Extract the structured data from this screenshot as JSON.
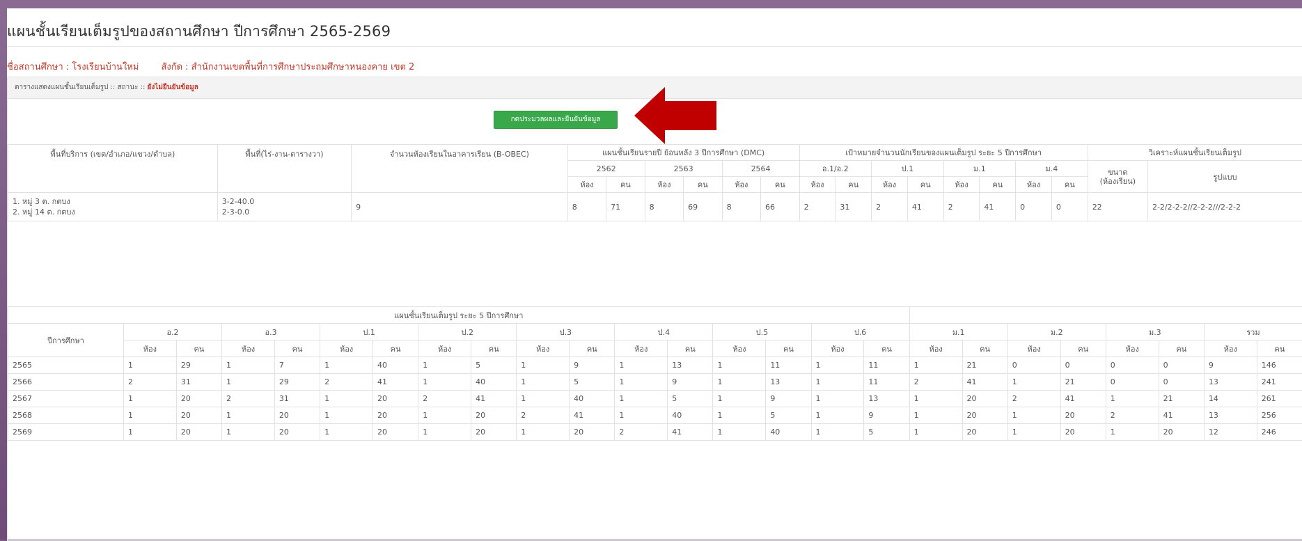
{
  "page": {
    "title": "แผนชั้นเรียนเต็มรูปของสถานศึกษา ปีการศึกษา 2565-2569",
    "school_label": "ชื่อสถานศึกษา : โรงเรียนบ้านใหม่",
    "affiliation_label": "สังกัด : สำนักงานเขตพื้นที่การศึกษาประถมศึกษาหนองคาย เขต 2"
  },
  "panel": {
    "header_prefix": "ตารางแสดงแผนชั้นเรียนเต็มรูป :: สถานะ :: ",
    "status": "ยังไม่ยืนยันข้อมูล",
    "process_button": "กดประมวลผลและยืนยันข้อมูล",
    "arrow_color": "#c00000",
    "button_color": "#39a84a"
  },
  "table1": {
    "headers": {
      "service_area": "พื้นที่บริการ (เขต/อำเภอ/แขวง/ตำบล)",
      "land_area": "พื้นที่(ไร่-งาน-ตารางวา)",
      "classrooms": "จำนวนห้องเรียนในอาคารเรียน (B-OBEC)",
      "plan_past": "แผนชั้นเรียนรายปี ย้อนหลัง 3 ปีการศึกษา (DMC)",
      "target": "เป้าหมายจำนวนนักเรียนของแผนเต็มรูป ระยะ 5 ปีการศึกษา",
      "analysis": "วิเคราะห์แผนชั้นเรียนเต็มรูป"
    },
    "years": [
      "2562",
      "2563",
      "2564"
    ],
    "target_levels": [
      "อ.1/อ.2",
      "ป.1",
      "ม.1",
      "ม.4"
    ],
    "room": "ห้อง",
    "person": "คน",
    "size_label": "ขนาด",
    "size_sub": "(ห้องเรียน)",
    "format_label": "รูปแบบ",
    "row": {
      "area_1": "1. หมู่ 3 ต. กตบง",
      "area_2": "2. หมู่ 14 ต. กตบง",
      "land_1": "3-2-40.0",
      "land_2": "2-3-0.0",
      "classrooms": "9",
      "values": [
        "8",
        "71",
        "8",
        "69",
        "8",
        "66",
        "2",
        "31",
        "2",
        "41",
        "2",
        "41",
        "0",
        "0"
      ],
      "size": "22",
      "format": "2-2/2-2-2//2-2-2///2-2-2"
    }
  },
  "table2": {
    "group_header": "แผนชั้นเรียนเต็มรูป ระยะ 5 ปีการศึกษา",
    "year_header": "ปีการศึกษา",
    "levels": [
      "อ.2",
      "อ.3",
      "ป.1",
      "ป.2",
      "ป.3",
      "ป.4",
      "ป.5",
      "ป.6",
      "ม.1",
      "ม.2",
      "ม.3",
      "รวม"
    ],
    "room": "ห้อง",
    "person": "คน",
    "rows": [
      {
        "year": "2565",
        "cells": [
          "1",
          "29",
          "1",
          "7",
          "1",
          "40",
          "1",
          "5",
          "1",
          "9",
          "1",
          "13",
          "1",
          "11",
          "1",
          "11",
          "1",
          "21",
          "0",
          "0",
          "0",
          "0",
          "9",
          "146"
        ]
      },
      {
        "year": "2566",
        "cells": [
          "2",
          "31",
          "1",
          "29",
          "2",
          "41",
          "1",
          "40",
          "1",
          "5",
          "1",
          "9",
          "1",
          "13",
          "1",
          "11",
          "2",
          "41",
          "1",
          "21",
          "0",
          "0",
          "13",
          "241"
        ]
      },
      {
        "year": "2567",
        "cells": [
          "1",
          "20",
          "2",
          "31",
          "1",
          "20",
          "2",
          "41",
          "1",
          "40",
          "1",
          "5",
          "1",
          "9",
          "1",
          "13",
          "1",
          "20",
          "2",
          "41",
          "1",
          "21",
          "14",
          "261"
        ]
      },
      {
        "year": "2568",
        "cells": [
          "1",
          "20",
          "1",
          "20",
          "1",
          "20",
          "1",
          "20",
          "2",
          "41",
          "1",
          "40",
          "1",
          "5",
          "1",
          "9",
          "1",
          "20",
          "1",
          "20",
          "2",
          "41",
          "13",
          "256"
        ]
      },
      {
        "year": "2569",
        "cells": [
          "1",
          "20",
          "1",
          "20",
          "1",
          "20",
          "1",
          "20",
          "1",
          "20",
          "2",
          "41",
          "1",
          "40",
          "1",
          "5",
          "1",
          "20",
          "1",
          "20",
          "1",
          "20",
          "12",
          "246"
        ]
      }
    ]
  }
}
